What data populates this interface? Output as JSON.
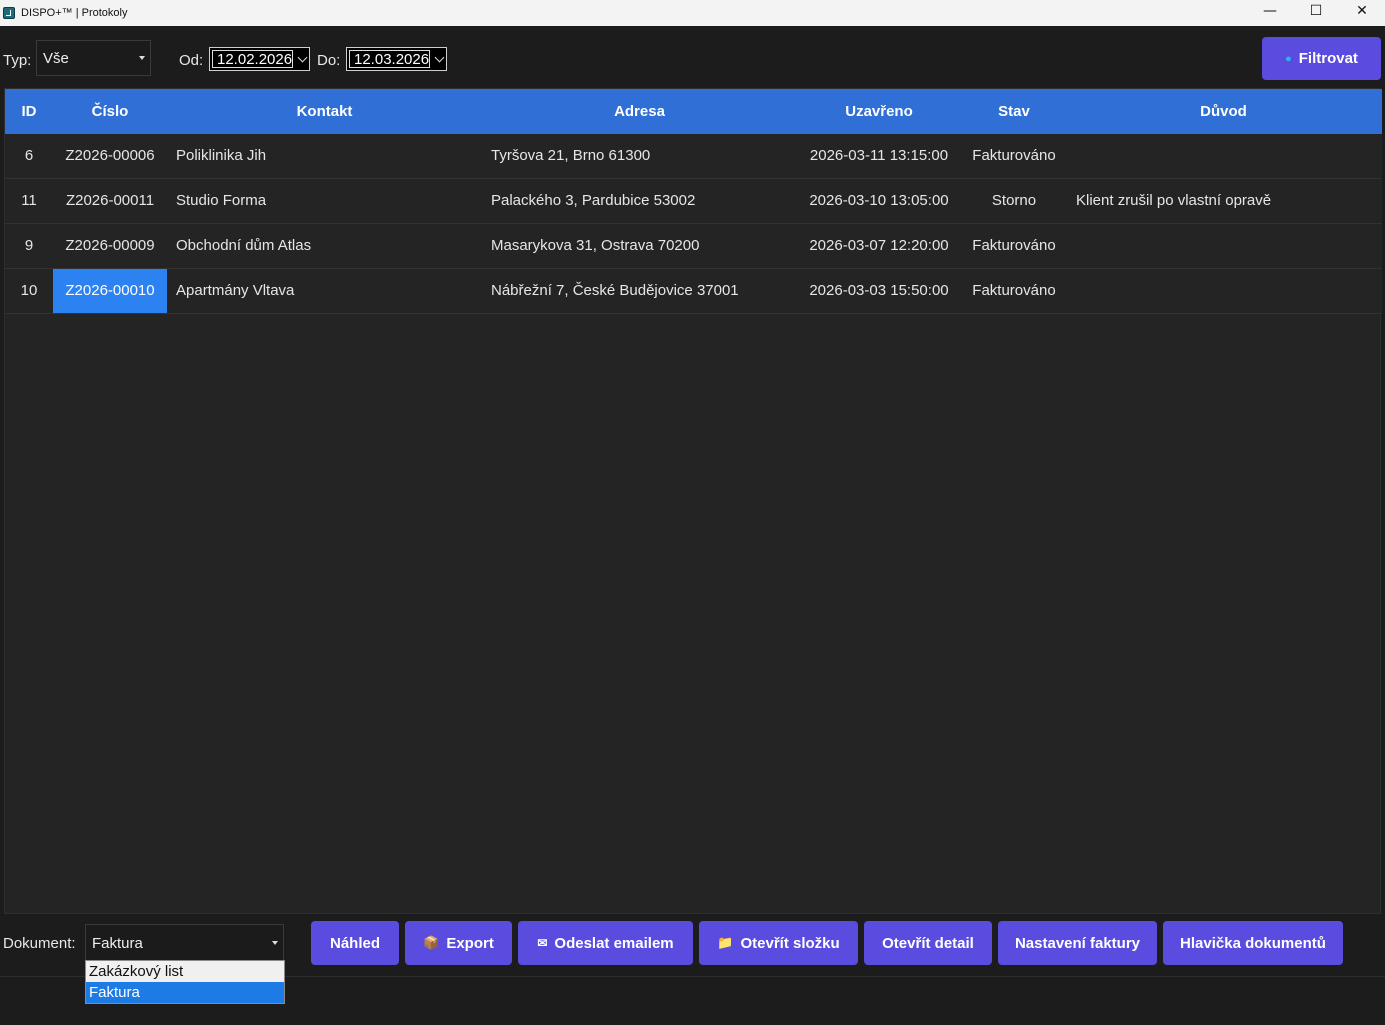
{
  "window": {
    "title": "DISPO+™ | Protokoly",
    "minimize": "—",
    "maximize": "☐",
    "close": "✕"
  },
  "filters": {
    "type_label": "Typ:",
    "type_value": "Vše",
    "from_label": "Od:",
    "from_value": "12.02.2026",
    "to_label": "Do:",
    "to_value": "12.03.2026",
    "filter_button": "Filtrovat"
  },
  "table": {
    "columns": [
      "ID",
      "Číslo",
      "Kontakt",
      "Adresa",
      "Uzavřeno",
      "Stav",
      "Důvod"
    ],
    "rows": [
      {
        "id": "6",
        "cislo": "Z2026-00006",
        "kontakt": "Poliklinika Jih",
        "adresa": "Tyršova 21, Brno 61300",
        "uzavreno": "2026-03-11 13:15:00",
        "stav": "Fakturováno",
        "duvod": ""
      },
      {
        "id": "11",
        "cislo": "Z2026-00011",
        "kontakt": "Studio Forma",
        "adresa": "Palackého 3, Pardubice 53002",
        "uzavreno": "2026-03-10 13:05:00",
        "stav": "Storno",
        "duvod": "Klient zrušil po vlastní opravě"
      },
      {
        "id": "9",
        "cislo": "Z2026-00009",
        "kontakt": "Obchodní dům Atlas",
        "adresa": "Masarykova 31, Ostrava 70200",
        "uzavreno": "2026-03-07 12:20:00",
        "stav": "Fakturováno",
        "duvod": ""
      },
      {
        "id": "10",
        "cislo": "Z2026-00010",
        "kontakt": "Apartmány Vltava",
        "adresa": "Nábřežní 7, České Budějovice 37001",
        "uzavreno": "2026-03-03 15:50:00",
        "stav": "Fakturováno",
        "duvod": ""
      }
    ]
  },
  "bottom": {
    "document_label": "Dokument:",
    "document_value": "Faktura",
    "document_options": [
      "Zakázkový list",
      "Faktura"
    ],
    "buttons": {
      "preview": "Náhled",
      "export": "Export",
      "email": "Odeslat emailem",
      "open_folder": "Otevřít složku",
      "open_detail": "Otevřít detail",
      "invoice_settings": "Nastavení faktury",
      "doc_header": "Hlavička dokumentů"
    }
  },
  "icons": {
    "filter_icon": "●",
    "export_icon": "📦",
    "email_icon": "✉",
    "folder_icon": "📁"
  },
  "colors": {
    "accent": "#5b4ce0",
    "header_blue": "#2f6fd6",
    "selection": "#2b82f0"
  }
}
